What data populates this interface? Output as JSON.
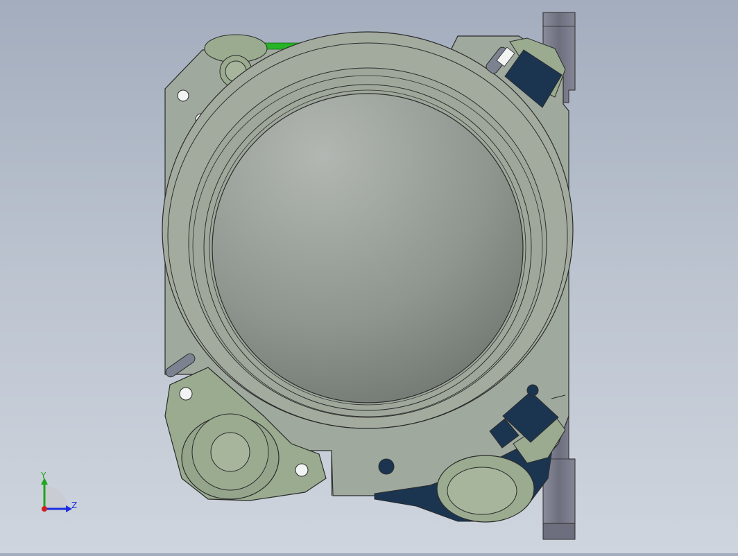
{
  "triad": {
    "y_label": "Y",
    "z_label": "Z",
    "y_color": "#1fa51f",
    "z_color": "#1a2ee0",
    "origin_color": "#d21f1f"
  },
  "colors": {
    "background_top": "#a3adbd",
    "background_bottom": "#cfd5de",
    "housing": "#9aa69a",
    "lens": "#9ea5a0",
    "roller": "#95a58c",
    "clamp": "#1b3550",
    "rail": "#7a7c8c",
    "edge": "#2b2b2b",
    "accent": "#27b427"
  }
}
